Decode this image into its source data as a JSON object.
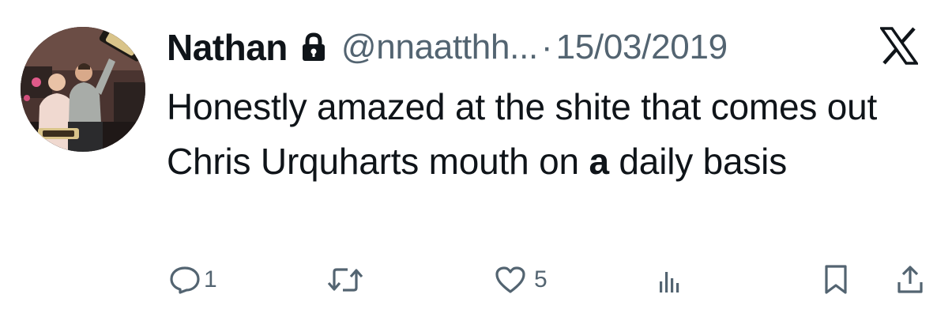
{
  "tweet": {
    "author_name": "Nathan",
    "handle": "@nnaatthh...",
    "separator": "·",
    "date": "15/03/2019",
    "text_part1": "Honestly amazed at the shite that comes out Chris Urquharts mouth on ",
    "text_bold": "a",
    "text_part2": " daily basis"
  },
  "actions": {
    "reply_count": "1",
    "retweet_count": "",
    "like_count": "5",
    "views_count": ""
  },
  "icons": {
    "lock": "lock-icon",
    "x_logo": "x-logo-icon",
    "reply": "reply-icon",
    "retweet": "retweet-icon",
    "like": "heart-icon",
    "views": "views-icon",
    "bookmark": "bookmark-icon",
    "share": "share-icon"
  },
  "colors": {
    "text": "#0f1419",
    "secondary": "#536471"
  }
}
